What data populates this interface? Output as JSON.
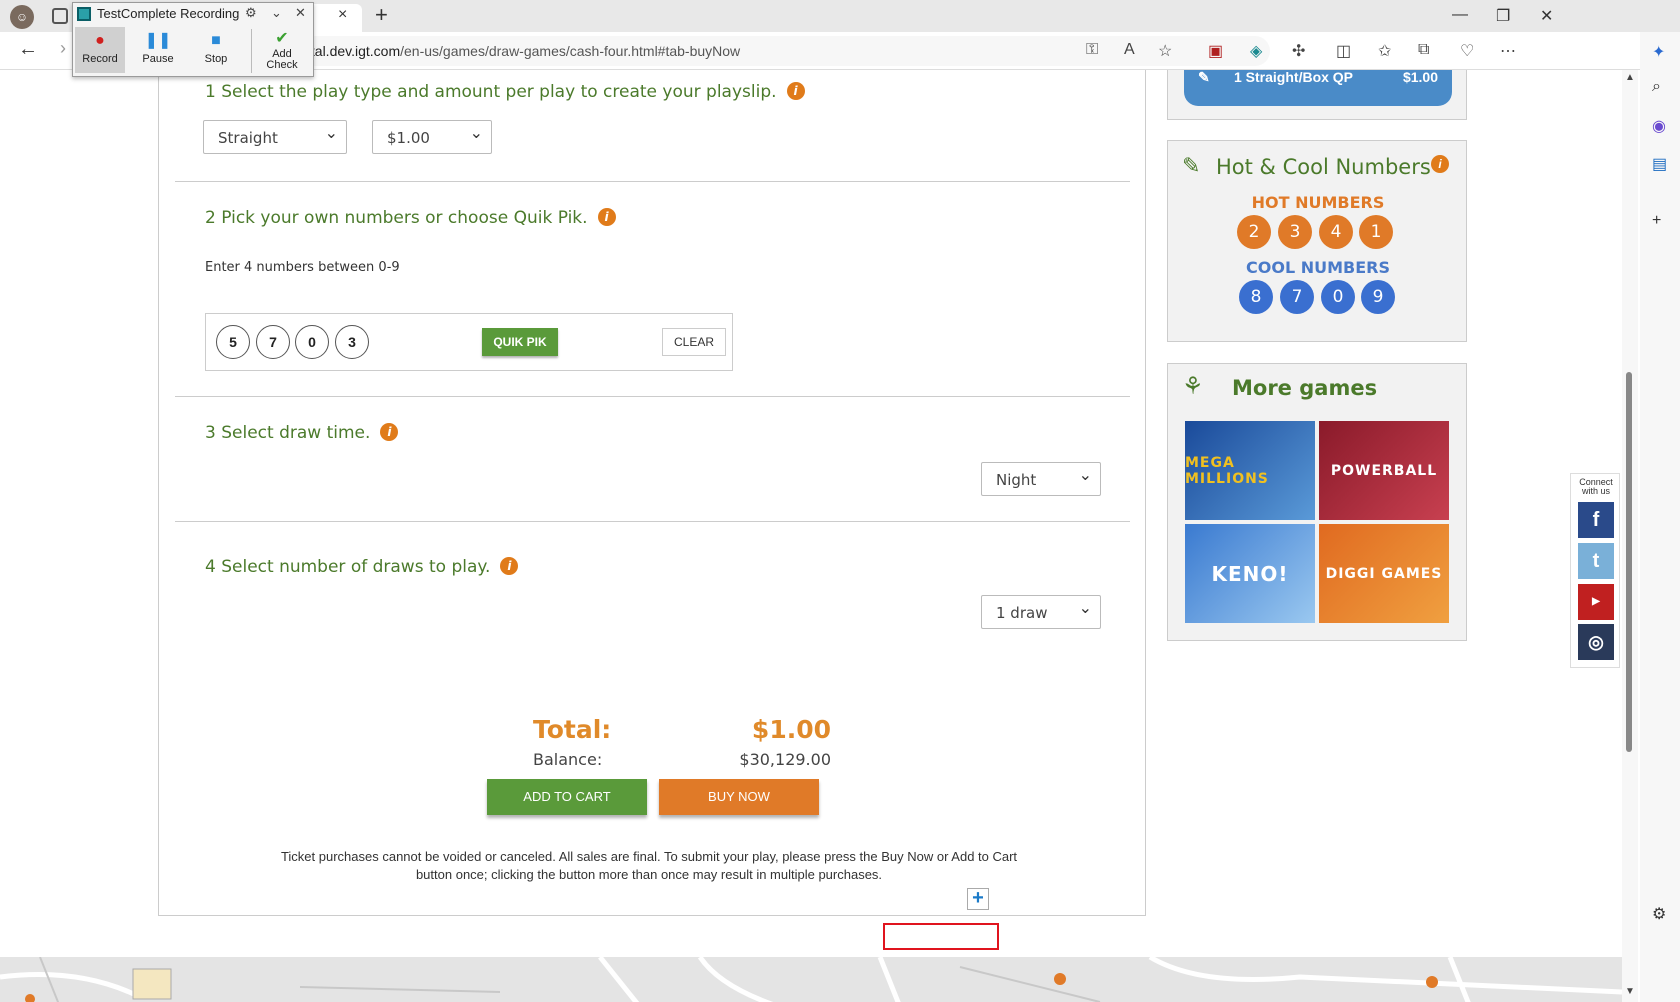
{
  "browser": {
    "url_prefix": "gital.dev.igt.com",
    "url_rest": "/en-us/games/draw-games/cash-four.html#tab-buyNow",
    "tab_close": "×",
    "new_tab": "+"
  },
  "testcomplete": {
    "title": "TestComplete Recording",
    "buttons": [
      {
        "label": "Record",
        "color": "#d0201e"
      },
      {
        "label": "Pause",
        "color": "#2a8ad8"
      },
      {
        "label": "Stop",
        "color": "#2a8ad8"
      },
      {
        "label": "Add\nCheck",
        "color": "#3aa030"
      }
    ]
  },
  "steps": {
    "s1": "1 Select the play type and amount per play to create your playslip.",
    "s2": "2 Pick your own numbers or choose Quik Pik.",
    "s3": "3 Select draw time.",
    "s4": "4 Select number of draws to play.",
    "info_glyph": "i"
  },
  "selects": {
    "play_type": "Straight",
    "amount": "$1.00",
    "draw_time": "Night",
    "draws": "1 draw"
  },
  "picker": {
    "note": "Enter 4 numbers between 0-9",
    "numbers": [
      "5",
      "7",
      "0",
      "3"
    ],
    "quik_pik": "QUIK PIK",
    "clear": "CLEAR"
  },
  "totals": {
    "total_label": "Total:",
    "total_value": "$1.00",
    "balance_label": "Balance:",
    "balance_value": "$30,129.00",
    "add_to_cart": "ADD TO CART",
    "buy_now": "BUY NOW",
    "disclaimer": "Ticket purchases cannot be voided or canceled. All sales are final. To submit your play, please press the Buy Now or Add to Cart button once; clicking the button more than once may result in multiple purchases."
  },
  "sidebar": {
    "playslip_label": "1 Straight/Box QP",
    "playslip_amount": "$1.00",
    "hot_cool_title": "Hot & Cool Numbers",
    "hot_label": "HOT NUMBERS",
    "hot_numbers": [
      "2",
      "3",
      "4",
      "1"
    ],
    "cool_label": "COOL NUMBERS",
    "cool_numbers": [
      "8",
      "7",
      "0",
      "9"
    ],
    "more_games_title": "More games",
    "games": [
      "MEGA MILLIONS",
      "POWERBALL",
      "KENO!",
      "DIGGI GAMES"
    ]
  },
  "connect": {
    "label": "Connect with us",
    "networks": [
      "facebook-icon",
      "twitter-icon",
      "youtube-icon",
      "instagram-icon"
    ]
  },
  "colors": {
    "green": "#4b7a2b",
    "orange": "#e07a28",
    "blue": "#3a6fd0"
  }
}
